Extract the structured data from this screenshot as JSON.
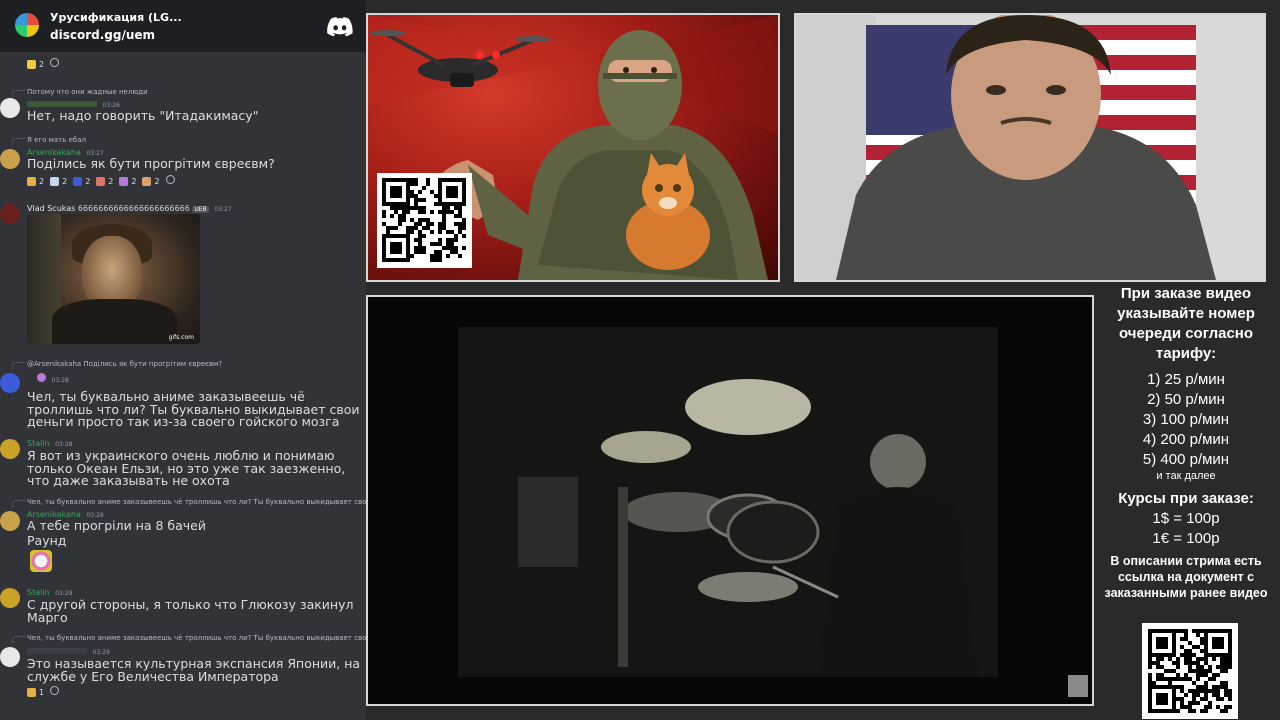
{
  "server": {
    "name": "Урусификация (LG...",
    "invite": "discord.gg/uem"
  },
  "messages": [
    {
      "id": "m0",
      "reactions": [
        {
          "count": "2",
          "color": "#f0c948"
        }
      ]
    },
    {
      "id": "m1",
      "reply": "Потому что они жадные нелюди",
      "timestamp": "03:26",
      "text": "Нет, надо говорить \"Итадакимасу\""
    },
    {
      "id": "m2",
      "reply": "Я его мать ебал",
      "author": "Arsenikakaha",
      "author_color": "#3ba55d",
      "timestamp": "03:27",
      "text": "Поділись як бути прогрітим євреєвм?",
      "reactions": [
        {
          "count": "2",
          "color": "#e3b341"
        },
        {
          "count": "2",
          "color": "#c7d7f0"
        },
        {
          "count": "2",
          "color": "#3b5bdb"
        },
        {
          "count": "2",
          "color": "#d9776b"
        },
        {
          "count": "2",
          "color": "#b87ae0"
        },
        {
          "count": "2",
          "color": "#e0a06b"
        }
      ]
    },
    {
      "id": "m3",
      "author": "Vlad Scukas",
      "author_extra": "6666666666666666666666",
      "author_color": "#e8e8e8",
      "tag": "UEB",
      "timestamp": "03:27",
      "gif_label": "gifs.com"
    },
    {
      "id": "m4",
      "reply": "@Arsenikakaha Поділись як бути прогрітим євреєвм?",
      "timestamp": "03:28",
      "text": "Чел, ты буквально аниме заказывеешь чё троллишь что ли? Ты буквально выкидывает свои деньги просто так из-за своего гойского мозга"
    },
    {
      "id": "m5",
      "author": "Stalin",
      "author_color": "#3ba55d",
      "timestamp": "03:28",
      "text": "Я вот из украинского очень люблю и понимаю только Океан Ельзи, но это уже так заезженно, что даже заказывать не охота"
    },
    {
      "id": "m6",
      "reply": "Чел, ты буквально аниме заказывеешь чё троллишь что ли? Ты буквально выкидывает свои",
      "author": "Arsenikakaha",
      "author_color": "#3ba55d",
      "timestamp": "03:28",
      "text": "А тебе прогріли на 8 бачей",
      "text2": "Раунд"
    },
    {
      "id": "m7",
      "author": "Stalin",
      "author_color": "#3ba55d",
      "timestamp": "03:29",
      "text": "С другой стороны, я только что Глюкозу закинул Марго"
    },
    {
      "id": "m8",
      "reply": "Чел, ты буквально аниме заказывеешь чё троллишь что ли? Ты буквально выкидывает свои",
      "timestamp": "03:29",
      "text": "Это называется культурная экспансия Японии, на службе у Его Величества Императора",
      "reactions": [
        {
          "count": "1",
          "color": "#e3b341"
        }
      ]
    }
  ],
  "info": {
    "heading": "При заказе видео указывайте номер очереди согласно тарифу:",
    "tariffs": [
      "1) 25 р/мин",
      "2) 50 р/мин",
      "3) 100 р/мин",
      "4) 200 р/мин",
      "5) 400 р/мин"
    ],
    "etc": "и так далее",
    "rates_heading": "Курсы при заказе:",
    "rates": [
      "1$ = 100р",
      "1€ = 100р"
    ],
    "description": "В описании стрима есть ссылка на документ с заказанными ранее видео"
  },
  "colors": {
    "discord_bg": "#313338",
    "header_bg": "#1e1f22",
    "poster_red": "#a71f18",
    "stream_bg": "#2a2a2a"
  }
}
